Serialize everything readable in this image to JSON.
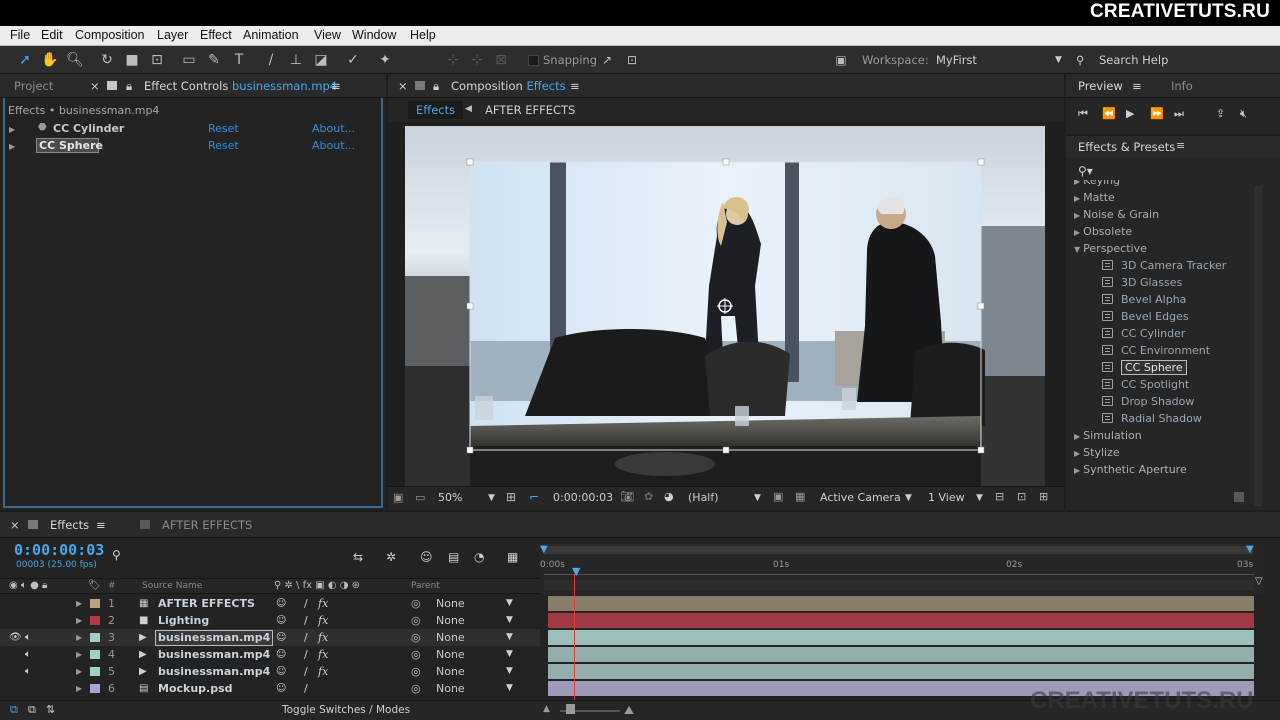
{
  "brand": "CREATIVETUTS.RU",
  "watermark": "CREATIVETUTS.RU",
  "menu": [
    "File",
    "Edit",
    "Composition",
    "Layer",
    "Effect",
    "Animation",
    "View",
    "Window",
    "Help"
  ],
  "toolbar": {
    "snapping_label": "Snapping",
    "workspace_label": "Workspace:",
    "workspace_value": "MyFirst",
    "search_help": "Search Help"
  },
  "left_panel": {
    "tab_project": "Project",
    "tab_effect_controls": "Effect Controls",
    "tab_effect_controls_file": "businessman.mp4",
    "path": "Effects • businessman.mp4",
    "effects": [
      {
        "name": "CC Cylinder",
        "reset": "Reset",
        "about": "About..."
      },
      {
        "name": "CC Sphere",
        "reset": "Reset",
        "about": "About..."
      }
    ]
  },
  "composition": {
    "tab_label": "Composition",
    "tab_name": "Effects",
    "breadcrumb_current": "Effects",
    "breadcrumb_next": "AFTER EFFECTS",
    "zoom": "50%",
    "timecode": "0:00:00:03",
    "resolution": "(Half)",
    "camera": "Active Camera",
    "view": "1 View"
  },
  "preview": {
    "tab_preview": "Preview",
    "tab_info": "Info"
  },
  "effects_presets": {
    "title": "Effects & Presets",
    "items": [
      {
        "label": "Keying",
        "type": "cat",
        "open": false
      },
      {
        "label": "Matte",
        "type": "cat",
        "open": false
      },
      {
        "label": "Noise & Grain",
        "type": "cat",
        "open": false
      },
      {
        "label": "Obsolete",
        "type": "cat",
        "open": false
      },
      {
        "label": "Perspective",
        "type": "cat",
        "open": true
      },
      {
        "label": "3D Camera Tracker",
        "type": "sub"
      },
      {
        "label": "3D Glasses",
        "type": "sub"
      },
      {
        "label": "Bevel Alpha",
        "type": "sub"
      },
      {
        "label": "Bevel Edges",
        "type": "sub"
      },
      {
        "label": "CC Cylinder",
        "type": "sub"
      },
      {
        "label": "CC Environment",
        "type": "sub"
      },
      {
        "label": "CC Sphere",
        "type": "sub",
        "selected": true
      },
      {
        "label": "CC Spotlight",
        "type": "sub"
      },
      {
        "label": "Drop Shadow",
        "type": "sub"
      },
      {
        "label": "Radial Shadow",
        "type": "sub"
      },
      {
        "label": "Simulation",
        "type": "cat",
        "open": false
      },
      {
        "label": "Stylize",
        "type": "cat",
        "open": false
      },
      {
        "label": "Synthetic Aperture",
        "type": "cat",
        "open": false
      }
    ]
  },
  "timeline": {
    "tab_effects": "Effects",
    "tab_after_effects": "AFTER EFFECTS",
    "timecode": "0:00:00:03",
    "frame_info": "00003 (25.00 fps)",
    "col_source_name": "Source Name",
    "col_parent": "Parent",
    "col_hash": "#",
    "ruler": [
      "0:00s",
      "01s",
      "02s",
      "03s"
    ],
    "toggle_label": "Toggle Switches / Modes",
    "layers": [
      {
        "num": "1",
        "name": "AFTER EFFECTS",
        "color": "#b9a17f",
        "bar": "#8a7d6a",
        "parent": "None",
        "kind": "comp"
      },
      {
        "num": "2",
        "name": "Lighting",
        "color": "#b43a45",
        "bar": "#a03a44",
        "parent": "None",
        "kind": "solid"
      },
      {
        "num": "3",
        "name": "businessman.mp4",
        "color": "#a3cfc9",
        "bar": "#9dbfbc",
        "parent": "None",
        "kind": "video",
        "selected": true
      },
      {
        "num": "4",
        "name": "businessman.mp4",
        "color": "#a3cfc9",
        "bar": "#94aeac",
        "parent": "None",
        "kind": "video"
      },
      {
        "num": "5",
        "name": "businessman.mp4",
        "color": "#a3cfc9",
        "bar": "#94aeac",
        "parent": "None",
        "kind": "video"
      },
      {
        "num": "6",
        "name": "Mockup.psd",
        "color": "#a8a3d6",
        "bar": "#9d9ab8",
        "parent": "None",
        "kind": "psd"
      }
    ]
  }
}
